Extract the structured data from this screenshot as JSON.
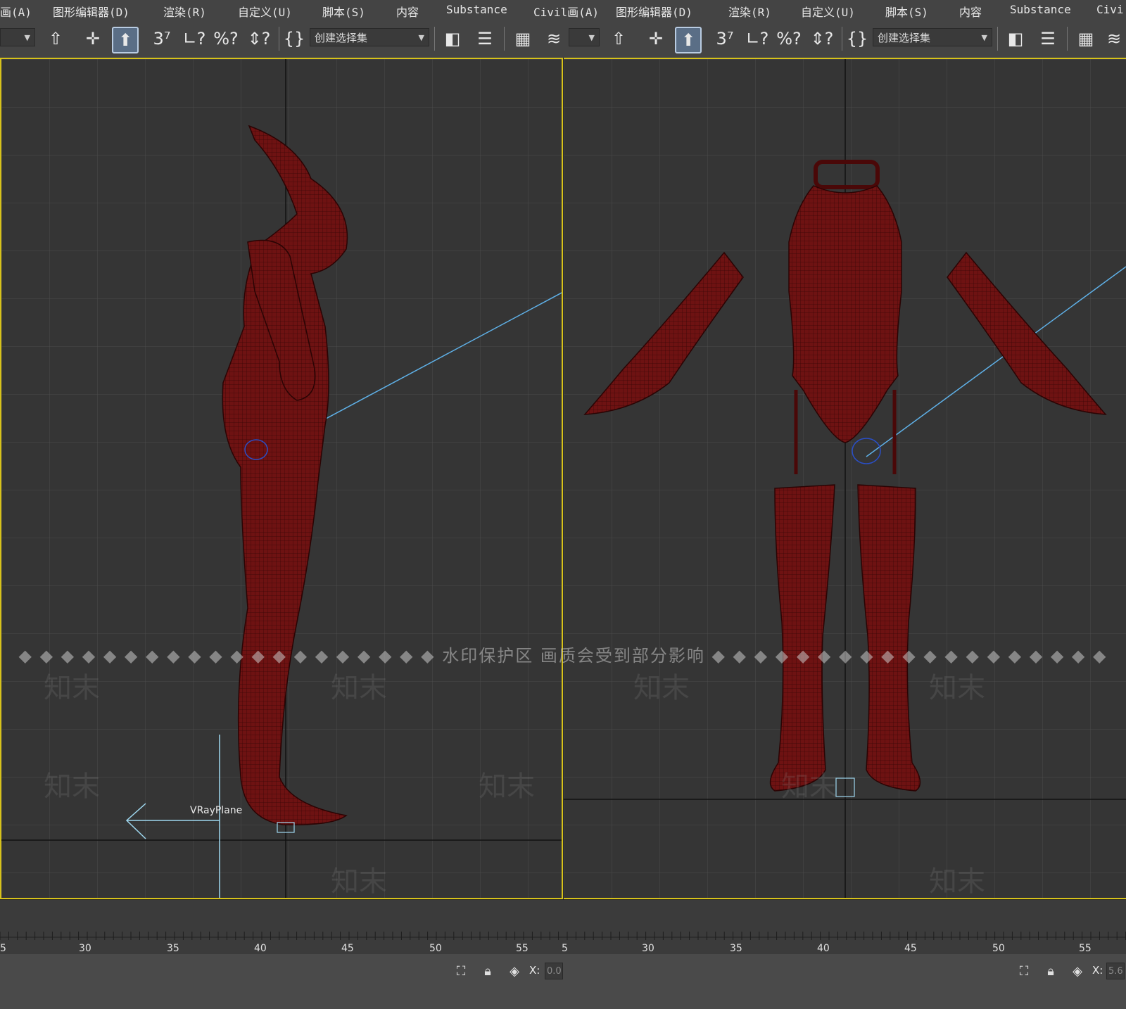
{
  "menus": [
    {
      "label": "画(A)"
    },
    {
      "label": "图形编辑器(D)"
    },
    {
      "label": "渲染(R)"
    },
    {
      "label": "自定义(U)"
    },
    {
      "label": "脚本(S)"
    },
    {
      "label": "内容"
    },
    {
      "label": "Substance"
    },
    {
      "label": "Civil画(A)"
    },
    {
      "label": "图形编辑器(D)"
    },
    {
      "label": "渲染(R)"
    },
    {
      "label": "自定义(U)"
    },
    {
      "label": "脚本(S)"
    },
    {
      "label": "内容"
    },
    {
      "label": "Substance"
    },
    {
      "label": "Civi"
    }
  ],
  "toolbar": {
    "selection_set_placeholder": "创建选择集",
    "icons": [
      "select-and-link-icon",
      "move-icon",
      "select-object-icon",
      "snap-3d-icon",
      "angle-snap-icon",
      "percent-snap-icon",
      "spinner-snap-icon",
      "named-selection-icon",
      "mirror-icon",
      "align-icon",
      "scene-explorer-icon",
      "layer-manager-icon"
    ]
  },
  "viewports": {
    "left": {
      "object_label": "VRayPlane"
    },
    "right": {}
  },
  "watermark": {
    "band_text": "◆ ◆ ◆ ◆ ◆ ◆ ◆ ◆ ◆ ◆ ◆ ◆ ◆ ◆ ◆ ◆ ◆ ◆ ◆ ◆ 水印保护区   画质会受到部分影响 ◆ ◆ ◆ ◆ ◆ ◆ ◆ ◆ ◆ ◆ ◆ ◆ ◆ ◆ ◆ ◆ ◆ ◆ ◆",
    "logo_text": "知末"
  },
  "timeline": {
    "ticks_left": [
      "5",
      "30",
      "35",
      "40",
      "45",
      "50",
      "55"
    ],
    "ticks_right": [
      "5",
      "30",
      "35",
      "40",
      "45",
      "50",
      "55"
    ]
  },
  "status": {
    "x_label_left": "X:",
    "x_value_left": "0.0",
    "x_label_right": "X:",
    "x_value_right": "5.6"
  },
  "colors": {
    "viewport_border": "#d7c21a",
    "mesh": "#6e1212",
    "mesh_wire": "#3a0606",
    "grid": "#4b4b4b",
    "guide_line": "#5fb1e8"
  }
}
